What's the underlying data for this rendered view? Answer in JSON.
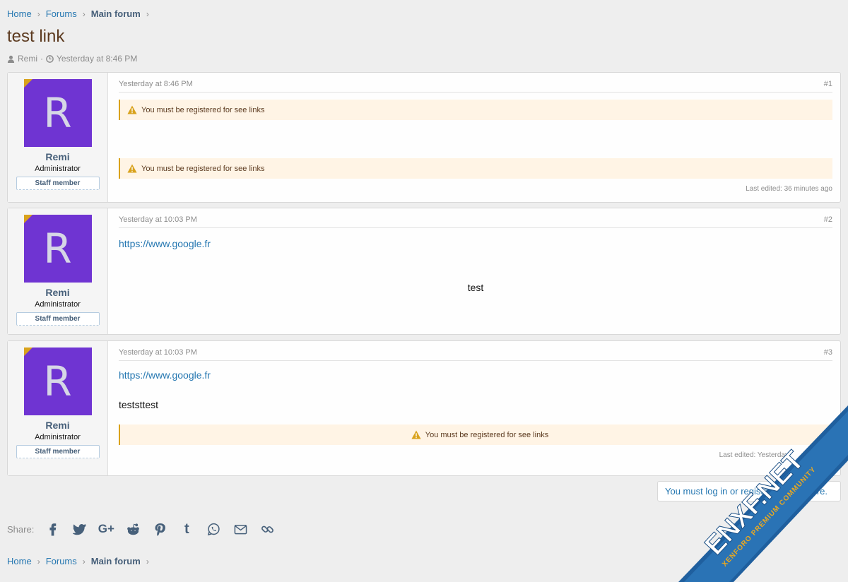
{
  "breadcrumbs": [
    {
      "label": "Home"
    },
    {
      "label": "Forums"
    },
    {
      "label": "Main forum"
    }
  ],
  "thread": {
    "title": "test link",
    "author": "Remi",
    "separator": "·",
    "date": "Yesterday at 8:46 PM"
  },
  "posts": [
    {
      "avatar_letter": "R",
      "username": "Remi",
      "user_title": "Administrator",
      "banner": "Staff member",
      "date": "Yesterday at 8:46 PM",
      "number": "#1",
      "notice_1": "You must be registered for see links",
      "notice_2": "You must be registered for see links",
      "edited": "Last edited: 36 minutes ago"
    },
    {
      "avatar_letter": "R",
      "username": "Remi",
      "user_title": "Administrator",
      "banner": "Staff member",
      "date": "Yesterday at 10:03 PM",
      "number": "#2",
      "link": "https://www.google.fr",
      "text": "test"
    },
    {
      "avatar_letter": "R",
      "username": "Remi",
      "user_title": "Administrator",
      "banner": "Staff member",
      "date": "Yesterday at 10:03 PM",
      "number": "#3",
      "link": "https://www.google.fr",
      "text": "teststtest",
      "notice_1": "You must be registered for see links",
      "edited": "Last edited: Yesterday"
    }
  ],
  "login_prompt": "You must log in or register to reply here.",
  "share": {
    "label": "Share:",
    "icons": [
      "facebook-icon",
      "twitter-icon",
      "google-plus-icon",
      "reddit-icon",
      "pinterest-icon",
      "tumblr-icon",
      "whatsapp-icon",
      "email-icon",
      "link-icon"
    ],
    "google_plus_glyph": "G+",
    "tumblr_glyph": "t"
  },
  "watermark": {
    "brand": "ENXF.NET",
    "tagline": "XENFORO PREMIUM COMMUNITY"
  },
  "colors": {
    "link": "#2577b1",
    "avatar": "#6f34d2",
    "notice_border": "#d9a21c",
    "notice_bg": "#fff4e5"
  }
}
